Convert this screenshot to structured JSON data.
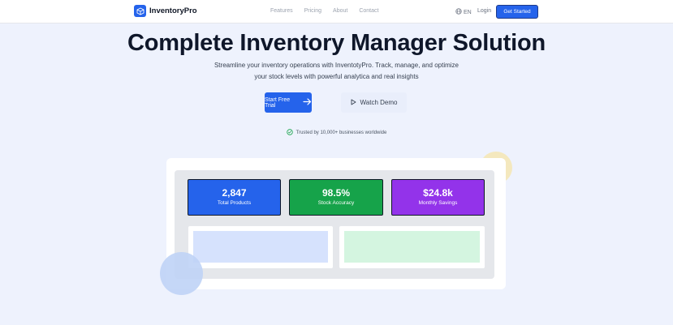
{
  "nav": {
    "brand": "InventoryPro",
    "links": [
      "Features",
      "Pricing",
      "About",
      "Contact"
    ],
    "language": "EN",
    "login": "Login",
    "cta": "Get Started"
  },
  "hero": {
    "title": "Complete Inventory Manager Solution",
    "subtitle_line1": "Streamline your inventory operations with InventotyPro. Track, manage, and optimize",
    "subtitle_line2": "your stock levels with powerful analytica and real insights",
    "primary_button": "Start Free Trial",
    "secondary_button": "Watch Demo",
    "trusted": "Trusted by 10,000+ businesses worldwide"
  },
  "dashboard": {
    "stats": [
      {
        "value": "2,847",
        "label": "Total Products",
        "color": "#2563eb"
      },
      {
        "value": "98.5%",
        "label": "Stock Accuracy",
        "color": "#16a34a"
      },
      {
        "value": "$24.8k",
        "label": "Monthly Savings",
        "color": "#9333ea"
      }
    ],
    "panel_colors": [
      "#d6e2fd",
      "#d4f5e0"
    ]
  },
  "colors": {
    "accent": "#2563eb",
    "background": "#eef2fd"
  }
}
